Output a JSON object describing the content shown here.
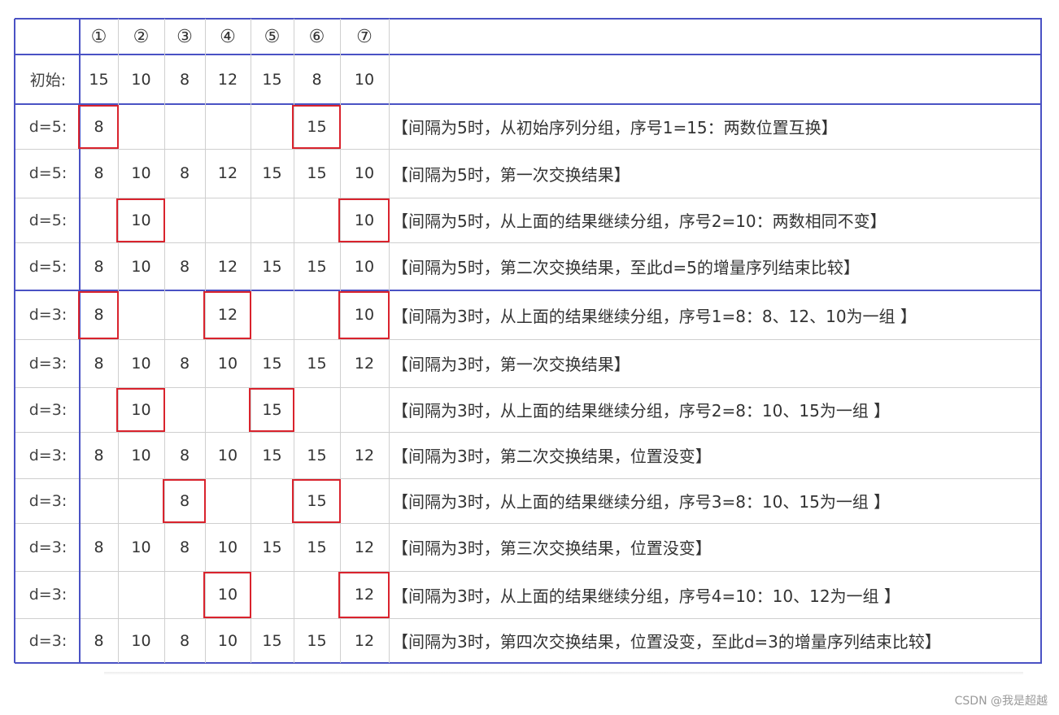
{
  "header": {
    "indices": [
      "①",
      "②",
      "③",
      "④",
      "⑤",
      "⑥",
      "⑦"
    ]
  },
  "rows": [
    {
      "label": "初始:",
      "cells": [
        "15",
        "10",
        "8",
        "12",
        "15",
        "8",
        "10"
      ],
      "note": ""
    },
    {
      "label": "d=5:",
      "cells": [
        "8",
        "",
        "",
        "",
        "",
        "15",
        ""
      ],
      "note": "【间隔为5时，从初始序列分组，序号1=15：两数位置互换】"
    },
    {
      "label": "d=5:",
      "cells": [
        "8",
        "10",
        "8",
        "12",
        "15",
        "15",
        "10"
      ],
      "note": "【间隔为5时，第一次交换结果】"
    },
    {
      "label": "d=5:",
      "cells": [
        "",
        "10",
        "",
        "",
        "",
        "",
        "10"
      ],
      "note": "【间隔为5时，从上面的结果继续分组，序号2=10：两数相同不变】"
    },
    {
      "label": "d=5:",
      "cells": [
        "8",
        "10",
        "8",
        "12",
        "15",
        "15",
        "10"
      ],
      "note": "【间隔为5时，第二次交换结果，至此d=5的增量序列结束比较】"
    },
    {
      "label": "d=3:",
      "cells": [
        "8",
        "",
        "",
        "12",
        "",
        "",
        "10"
      ],
      "note": "【间隔为3时，从上面的结果继续分组，序号1=8：8、12、10为一组 】"
    },
    {
      "label": "d=3:",
      "cells": [
        "8",
        "10",
        "8",
        "10",
        "15",
        "15",
        "12"
      ],
      "note": "【间隔为3时，第一次交换结果】"
    },
    {
      "label": "d=3:",
      "cells": [
        "",
        "10",
        "",
        "",
        "15",
        "",
        ""
      ],
      "note": "【间隔为3时，从上面的结果继续分组，序号2=8：10、15为一组 】"
    },
    {
      "label": "d=3:",
      "cells": [
        "8",
        "10",
        "8",
        "10",
        "15",
        "15",
        "12"
      ],
      "note": "【间隔为3时，第二次交换结果，位置没变】"
    },
    {
      "label": "d=3:",
      "cells": [
        "",
        "",
        "8",
        "",
        "",
        "15",
        ""
      ],
      "note": "【间隔为3时，从上面的结果继续分组，序号3=8：10、15为一组 】"
    },
    {
      "label": "d=3:",
      "cells": [
        "8",
        "10",
        "8",
        "10",
        "15",
        "15",
        "12"
      ],
      "note": "【间隔为3时，第三次交换结果，位置没变】"
    },
    {
      "label": "d=3:",
      "cells": [
        "",
        "",
        "",
        "10",
        "",
        "",
        "12"
      ],
      "note": "【间隔为3时，从上面的结果继续分组，序号4=10：10、12为一组 】"
    },
    {
      "label": "d=3:",
      "cells": [
        "8",
        "10",
        "8",
        "10",
        "15",
        "15",
        "12"
      ],
      "note": "【间隔为3时，第四次交换结果，位置没变，至此d=3的增量序列结束比较】"
    }
  ],
  "watermark": "CSDN @我是超越",
  "colors": {
    "grid_border": "#4a52c4",
    "highlight": "#d9232d",
    "inner_grid": "#cfcfcf"
  }
}
